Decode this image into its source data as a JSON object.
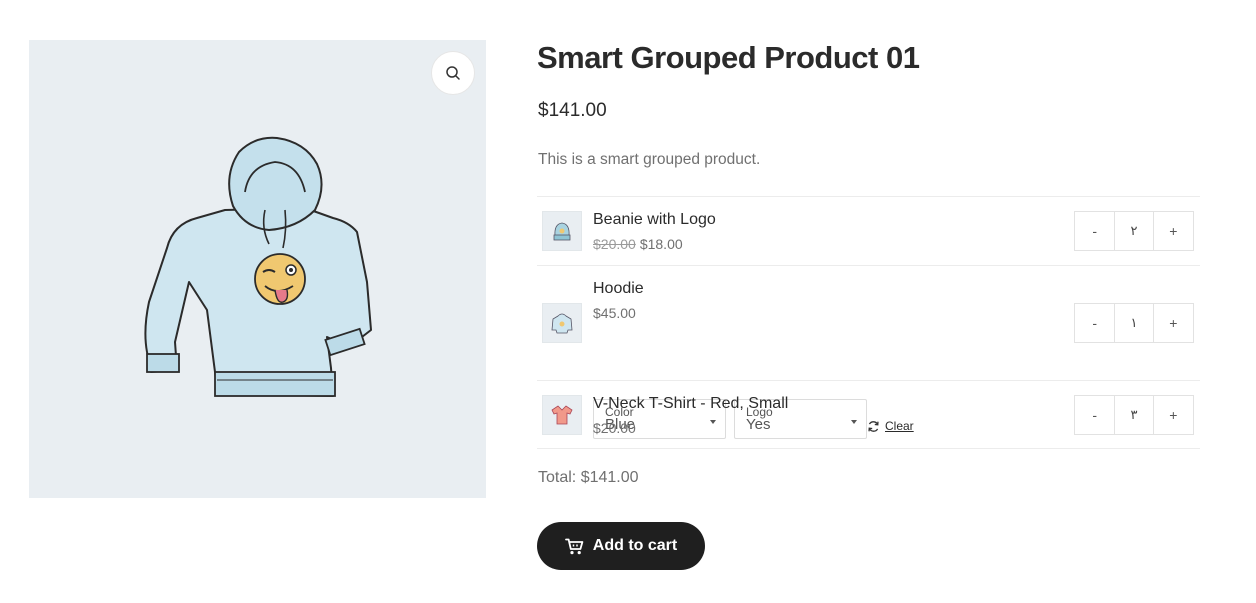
{
  "product": {
    "title": "Smart Grouped Product 01",
    "price": "$141.00",
    "description": "This is a smart grouped product."
  },
  "gallery": {
    "zoom_icon": "search-icon"
  },
  "items": [
    {
      "name": "Beanie with Logo",
      "old_price": "$20.00",
      "price": "$18.00",
      "qty": "٢",
      "minus": "-",
      "plus": "+"
    },
    {
      "name": "Hoodie",
      "price": "$45.00",
      "qty": "١",
      "minus": "-",
      "plus": "+",
      "attributes": [
        {
          "label": "Color",
          "value": "Blue"
        },
        {
          "label": "Logo",
          "value": "Yes"
        }
      ],
      "clear_label": "Clear"
    },
    {
      "name": "V-Neck T-Shirt - Red, Small",
      "price": "$20.00",
      "qty": "٣",
      "minus": "-",
      "plus": "+"
    }
  ],
  "total": "Total: $141.00",
  "add_to_cart": {
    "label": "Add to cart",
    "icon": "cart-icon"
  },
  "colors": {
    "button_bg": "#1f1f1f",
    "gallery_bg": "#e9eef2",
    "hoodie": "#cfe6f0"
  }
}
